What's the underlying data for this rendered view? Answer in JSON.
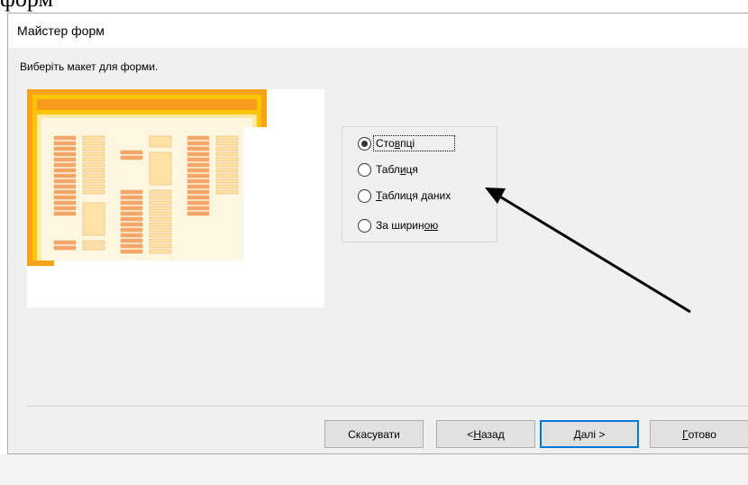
{
  "page_text_fragment": "форм",
  "window": {
    "title": "Майстер форм"
  },
  "instruction": "Виберіть макет для форми.",
  "layout_options": [
    {
      "pre": "Сто",
      "mnemonic": "в",
      "post": "пці",
      "selected": true
    },
    {
      "pre": "Табл",
      "mnemonic": "и",
      "post": "ця",
      "selected": false
    },
    {
      "pre": "",
      "mnemonic": "Т",
      "post": "аблиця даних",
      "selected": false
    },
    {
      "pre": "За ширин",
      "mnemonic": "ою",
      "post": "",
      "selected": false
    }
  ],
  "buttons": {
    "cancel": {
      "pre": "Скасувати",
      "mnemonic": "",
      "post": ""
    },
    "back": {
      "pre": "< ",
      "mnemonic": "Н",
      "post": "азад"
    },
    "next": {
      "pre": "",
      "mnemonic": "Д",
      "post": "алі >"
    },
    "finish": {
      "pre": "",
      "mnemonic": "Г",
      "post": "отово"
    }
  },
  "colors": {
    "preview_frame": "#f7a21b",
    "preview_panel": "#fff3d9",
    "preview_field_dark": "#f7a56a",
    "preview_field_light": "#ffe3a6",
    "default_button_border": "#0078d7"
  },
  "annotation": {
    "icon": "arrow-pointer"
  }
}
